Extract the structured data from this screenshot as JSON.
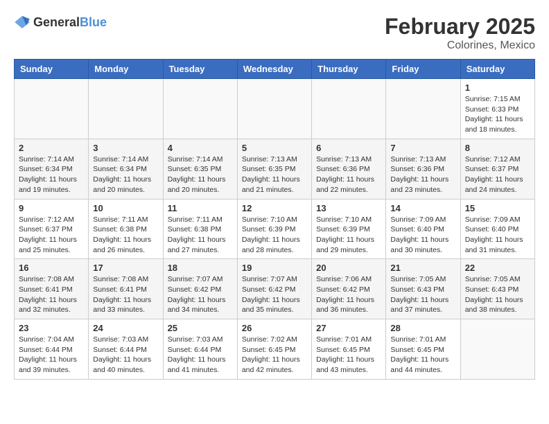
{
  "header": {
    "logo_general": "General",
    "logo_blue": "Blue",
    "month_title": "February 2025",
    "subtitle": "Colorines, Mexico"
  },
  "days_of_week": [
    "Sunday",
    "Monday",
    "Tuesday",
    "Wednesday",
    "Thursday",
    "Friday",
    "Saturday"
  ],
  "weeks": [
    [
      {
        "day": "",
        "info": ""
      },
      {
        "day": "",
        "info": ""
      },
      {
        "day": "",
        "info": ""
      },
      {
        "day": "",
        "info": ""
      },
      {
        "day": "",
        "info": ""
      },
      {
        "day": "",
        "info": ""
      },
      {
        "day": "1",
        "info": "Sunrise: 7:15 AM\nSunset: 6:33 PM\nDaylight: 11 hours and 18 minutes."
      }
    ],
    [
      {
        "day": "2",
        "info": "Sunrise: 7:14 AM\nSunset: 6:34 PM\nDaylight: 11 hours and 19 minutes."
      },
      {
        "day": "3",
        "info": "Sunrise: 7:14 AM\nSunset: 6:34 PM\nDaylight: 11 hours and 20 minutes."
      },
      {
        "day": "4",
        "info": "Sunrise: 7:14 AM\nSunset: 6:35 PM\nDaylight: 11 hours and 20 minutes."
      },
      {
        "day": "5",
        "info": "Sunrise: 7:13 AM\nSunset: 6:35 PM\nDaylight: 11 hours and 21 minutes."
      },
      {
        "day": "6",
        "info": "Sunrise: 7:13 AM\nSunset: 6:36 PM\nDaylight: 11 hours and 22 minutes."
      },
      {
        "day": "7",
        "info": "Sunrise: 7:13 AM\nSunset: 6:36 PM\nDaylight: 11 hours and 23 minutes."
      },
      {
        "day": "8",
        "info": "Sunrise: 7:12 AM\nSunset: 6:37 PM\nDaylight: 11 hours and 24 minutes."
      }
    ],
    [
      {
        "day": "9",
        "info": "Sunrise: 7:12 AM\nSunset: 6:37 PM\nDaylight: 11 hours and 25 minutes."
      },
      {
        "day": "10",
        "info": "Sunrise: 7:11 AM\nSunset: 6:38 PM\nDaylight: 11 hours and 26 minutes."
      },
      {
        "day": "11",
        "info": "Sunrise: 7:11 AM\nSunset: 6:38 PM\nDaylight: 11 hours and 27 minutes."
      },
      {
        "day": "12",
        "info": "Sunrise: 7:10 AM\nSunset: 6:39 PM\nDaylight: 11 hours and 28 minutes."
      },
      {
        "day": "13",
        "info": "Sunrise: 7:10 AM\nSunset: 6:39 PM\nDaylight: 11 hours and 29 minutes."
      },
      {
        "day": "14",
        "info": "Sunrise: 7:09 AM\nSunset: 6:40 PM\nDaylight: 11 hours and 30 minutes."
      },
      {
        "day": "15",
        "info": "Sunrise: 7:09 AM\nSunset: 6:40 PM\nDaylight: 11 hours and 31 minutes."
      }
    ],
    [
      {
        "day": "16",
        "info": "Sunrise: 7:08 AM\nSunset: 6:41 PM\nDaylight: 11 hours and 32 minutes."
      },
      {
        "day": "17",
        "info": "Sunrise: 7:08 AM\nSunset: 6:41 PM\nDaylight: 11 hours and 33 minutes."
      },
      {
        "day": "18",
        "info": "Sunrise: 7:07 AM\nSunset: 6:42 PM\nDaylight: 11 hours and 34 minutes."
      },
      {
        "day": "19",
        "info": "Sunrise: 7:07 AM\nSunset: 6:42 PM\nDaylight: 11 hours and 35 minutes."
      },
      {
        "day": "20",
        "info": "Sunrise: 7:06 AM\nSunset: 6:42 PM\nDaylight: 11 hours and 36 minutes."
      },
      {
        "day": "21",
        "info": "Sunrise: 7:05 AM\nSunset: 6:43 PM\nDaylight: 11 hours and 37 minutes."
      },
      {
        "day": "22",
        "info": "Sunrise: 7:05 AM\nSunset: 6:43 PM\nDaylight: 11 hours and 38 minutes."
      }
    ],
    [
      {
        "day": "23",
        "info": "Sunrise: 7:04 AM\nSunset: 6:44 PM\nDaylight: 11 hours and 39 minutes."
      },
      {
        "day": "24",
        "info": "Sunrise: 7:03 AM\nSunset: 6:44 PM\nDaylight: 11 hours and 40 minutes."
      },
      {
        "day": "25",
        "info": "Sunrise: 7:03 AM\nSunset: 6:44 PM\nDaylight: 11 hours and 41 minutes."
      },
      {
        "day": "26",
        "info": "Sunrise: 7:02 AM\nSunset: 6:45 PM\nDaylight: 11 hours and 42 minutes."
      },
      {
        "day": "27",
        "info": "Sunrise: 7:01 AM\nSunset: 6:45 PM\nDaylight: 11 hours and 43 minutes."
      },
      {
        "day": "28",
        "info": "Sunrise: 7:01 AM\nSunset: 6:45 PM\nDaylight: 11 hours and 44 minutes."
      },
      {
        "day": "",
        "info": ""
      }
    ]
  ]
}
